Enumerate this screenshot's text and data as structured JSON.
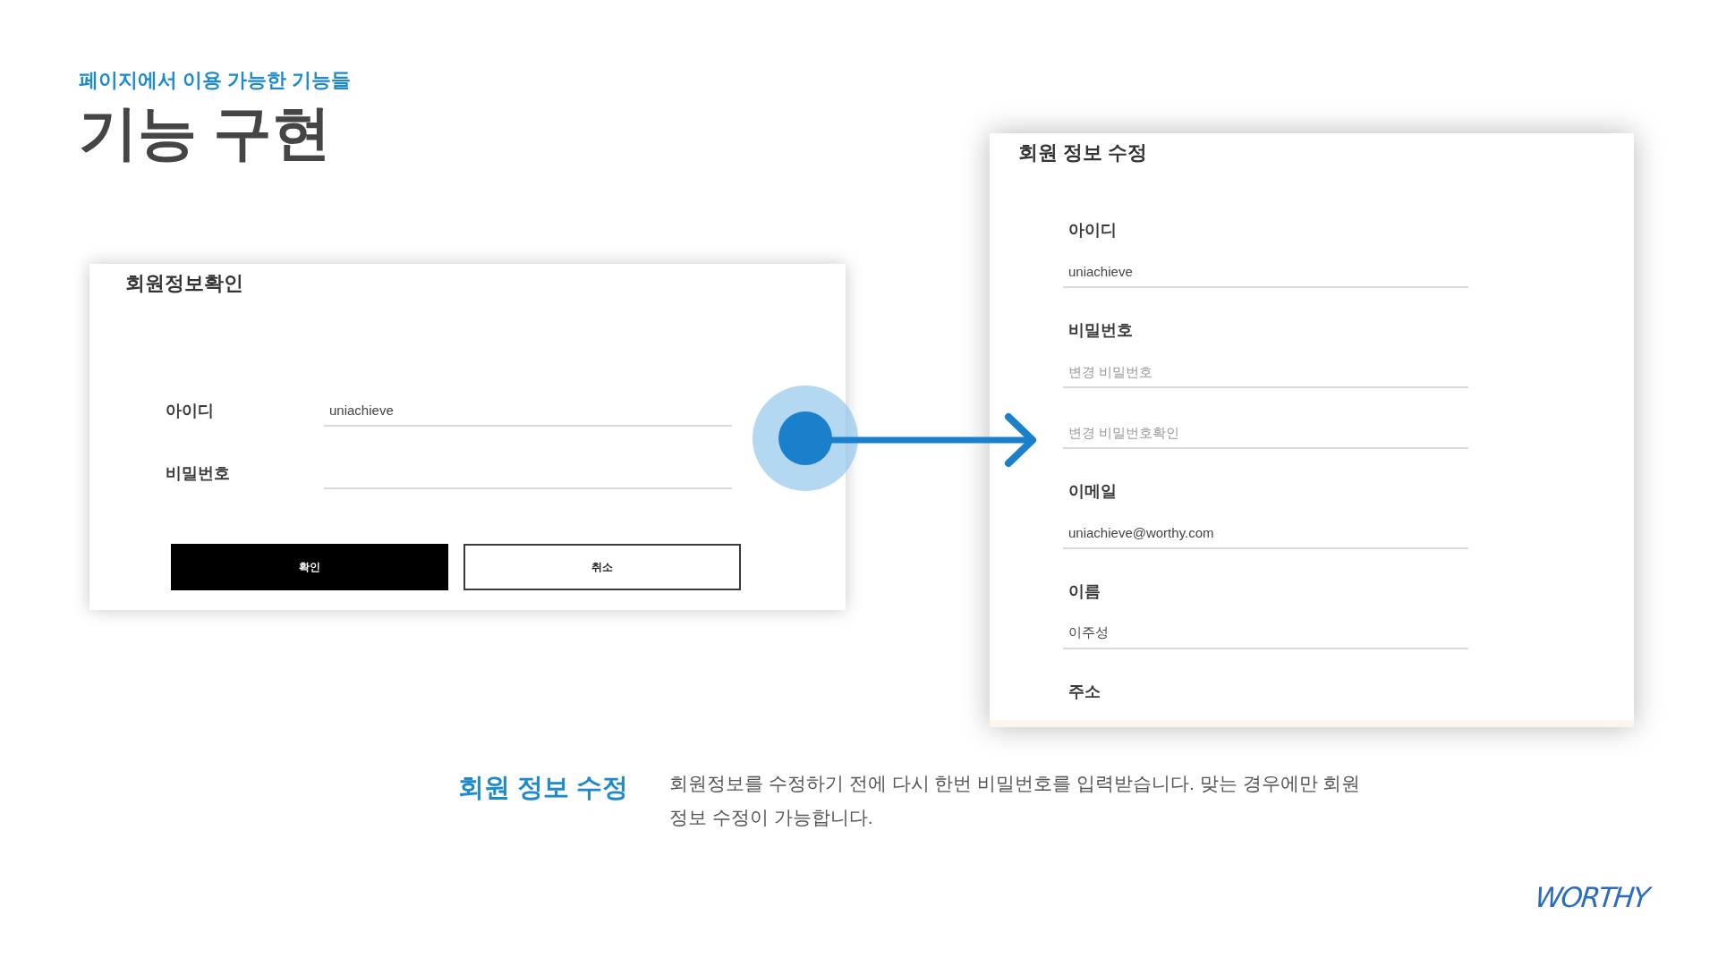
{
  "header": {
    "eyebrow": "페이지에서 이용 가능한 기능들",
    "title": "기능 구현"
  },
  "verify_panel": {
    "title": "회원정보확인",
    "fields": [
      {
        "label": "아이디",
        "value": "uniachieve"
      },
      {
        "label": "비밀번호"
      }
    ],
    "buttons": [
      {
        "label": "확인",
        "kind": "primary"
      },
      {
        "label": "취소",
        "kind": "secondary"
      }
    ]
  },
  "edit_panel": {
    "title": "회원 정보 수정",
    "fields": [
      {
        "label": "아이디",
        "value": "uniachieve"
      },
      {
        "label": "비밀번호",
        "placeholder": "변경 비밀번호"
      },
      {
        "placeholder": "변경 비밀번호확인"
      },
      {
        "label": "이메일",
        "value": "uniachieve@worthy.com"
      },
      {
        "label": "이름",
        "value": "이주성"
      },
      {
        "label": "주소"
      }
    ]
  },
  "caption": {
    "title": "회원 정보 수정",
    "text": "회원정보를 수정하기 전에 다시 한번 비밀번호를 입력받습니다. 맞는 경우에만 회원 정보 수정이 가능합니다."
  },
  "logo": "WORTHY"
}
